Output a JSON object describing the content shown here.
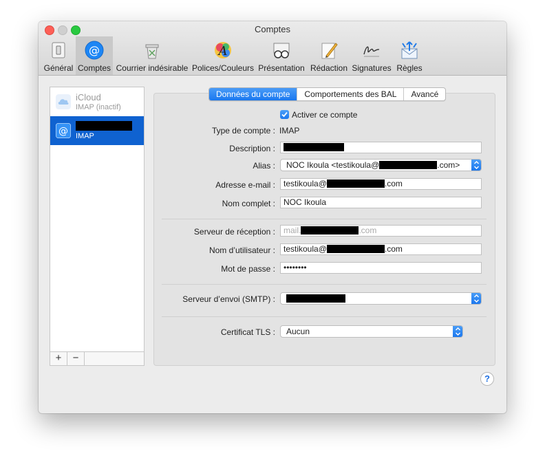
{
  "window": {
    "title": "Comptes"
  },
  "toolbar": {
    "items": [
      {
        "label": "Général"
      },
      {
        "label": "Comptes"
      },
      {
        "label": "Courrier indésirable"
      },
      {
        "label": "Polices/Couleurs"
      },
      {
        "label": "Présentation"
      },
      {
        "label": "Rédaction"
      },
      {
        "label": "Signatures"
      },
      {
        "label": "Règles"
      }
    ],
    "active": "Comptes"
  },
  "sidebar": {
    "accounts": [
      {
        "name": "iCloud",
        "type": "IMAP (inactif)"
      },
      {
        "name": "",
        "type": "IMAP"
      }
    ],
    "add_label": "+",
    "remove_label": "−"
  },
  "tabs": [
    {
      "label": "Données du compte"
    },
    {
      "label": "Comportements des BAL"
    },
    {
      "label": "Avancé"
    }
  ],
  "form": {
    "enable_label": "Activer ce compte",
    "enabled": true,
    "type_label": "Type de compte :",
    "type_value": "IMAP",
    "description_label": "Description :",
    "alias_label": "Alias :",
    "alias_prefix": "NOC Ikoula <testikoula@",
    "alias_suffix": ".com>",
    "email_label": "Adresse e-mail :",
    "email_prefix": "testikoula@",
    "email_suffix": ".com",
    "fullname_label": "Nom complet :",
    "fullname_value": "NOC Ikoula",
    "incoming_label": "Serveur de réception :",
    "incoming_prefix": "mail.",
    "incoming_suffix": ".com",
    "username_label": "Nom d’utilisateur :",
    "username_prefix": "testikoula@",
    "username_suffix": ".com",
    "password_label": "Mot de passe :",
    "password_value": "••••••••",
    "smtp_label": "Serveur d’envoi (SMTP) :",
    "tls_label": "Certificat TLS :",
    "tls_value": "Aucun"
  },
  "help": {
    "label": "?"
  },
  "colors": {
    "accent": "#1a78ef",
    "selection": "#0f62d0",
    "redaction": "#000000"
  }
}
